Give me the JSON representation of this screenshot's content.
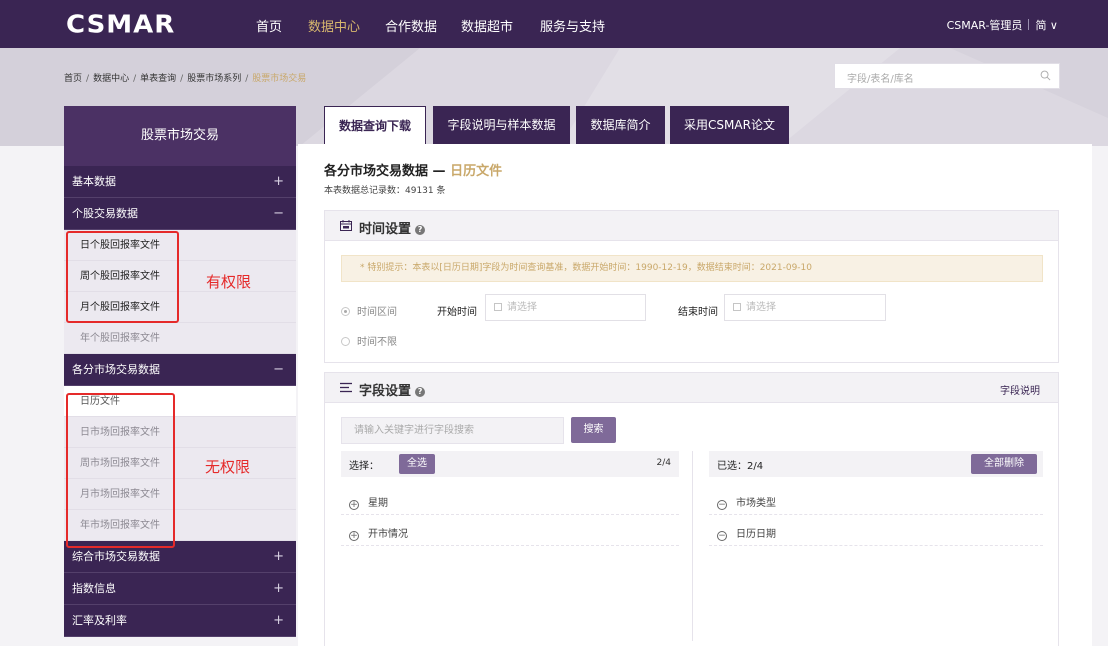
{
  "nav": {
    "logo": "CSMAR",
    "items": [
      "首页",
      "数据中心",
      "合作数据",
      "数据超市",
      "服务与支持"
    ],
    "active_index": 1,
    "user": "CSMAR-管理员",
    "lang": "简 ∨"
  },
  "breadcrumb": {
    "items": [
      "首页",
      "数据中心",
      "单表查询",
      "股票市场系列"
    ],
    "separator": "/",
    "current": "股票市场交易"
  },
  "search": {
    "placeholder": "字段/表名/库名",
    "icon": "search-icon"
  },
  "sidebar": {
    "title": "股票市场交易",
    "categories": [
      {
        "label": "基本数据",
        "toggle": "+"
      },
      {
        "label": "个股交易数据",
        "toggle": "−"
      },
      {
        "label": "各分市场交易数据",
        "toggle": "−"
      },
      {
        "label": "综合市场交易数据",
        "toggle": "+"
      },
      {
        "label": "指数信息",
        "toggle": "+"
      },
      {
        "label": "汇率及利率",
        "toggle": "+"
      }
    ],
    "stock_items": [
      "日个股回报率文件",
      "周个股回报率文件",
      "月个股回报率文件",
      "年个股回报率文件"
    ],
    "market_items": [
      "日历文件",
      "日市场回报率文件",
      "周市场回报率文件",
      "月市场回报率文件",
      "年市场回报率文件"
    ],
    "annotation_has_permission": "有权限",
    "annotation_no_permission": "无权限"
  },
  "tabs": [
    "数据查询下载",
    "字段说明与样本数据",
    "数据库简介",
    "采用CSMAR论文"
  ],
  "content": {
    "title_prefix": "各分市场交易数据 — ",
    "title_highlight": "日历文件",
    "record_count": "本表数据总记录数：49131 条"
  },
  "time_panel": {
    "title": "时间设置",
    "help": "?",
    "notice": "* 特别提示：本表以[日历日期]字段为时间查询基准，数据开始时间：1990-12-19，数据结束时间：2021-09-10",
    "radio_range": "时间区间",
    "radio_unlimited": "时间不限",
    "start_label": "开始时间",
    "end_label": "结束时间",
    "date_placeholder": "请选择"
  },
  "field_panel": {
    "title": "字段设置",
    "help": "?",
    "link": "字段说明",
    "search_placeholder": "请输入关键字进行字段搜索",
    "search_button": "搜索",
    "select_label": "选择：",
    "select_all": "全选",
    "left_count": "2/4",
    "selected_label": "已选：2/4",
    "delete_all": "全部删除",
    "available": [
      "星期",
      "开市情况"
    ],
    "selected": [
      "市场类型",
      "日历日期"
    ]
  },
  "colors": {
    "nav_bg": "#3a2553",
    "accent_gold": "#c9a86a",
    "annotation_red": "#e52a2a"
  }
}
